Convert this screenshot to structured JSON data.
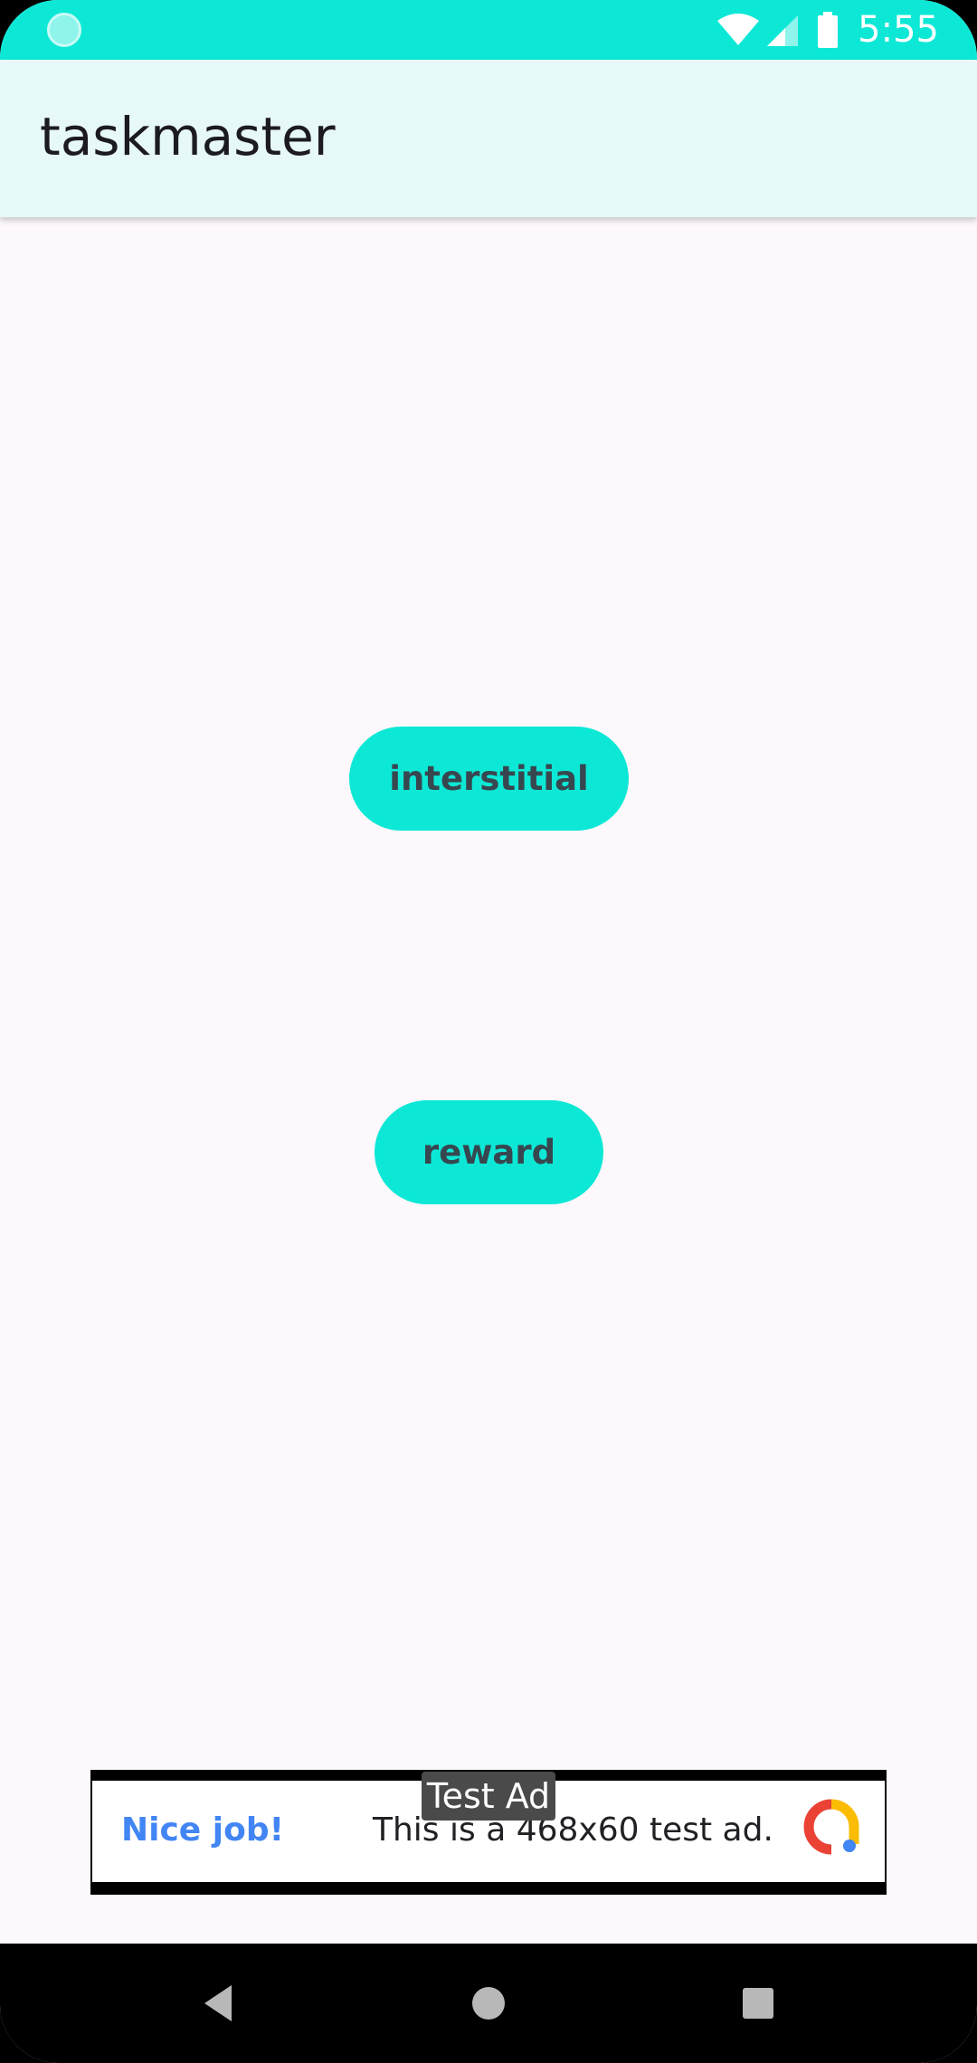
{
  "status_bar": {
    "time": "5:55",
    "icons": [
      "wifi-icon",
      "signal-icon",
      "battery-icon"
    ],
    "color": "#0de8d6"
  },
  "app_bar": {
    "title": "taskmaster"
  },
  "buttons": {
    "interstitial_label": "interstitial",
    "reward_label": "reward",
    "color": "#0de8d6"
  },
  "ad": {
    "tag": "Test Ad",
    "headline": "Nice job!",
    "body": "This is a 468x60 test ad.",
    "logo": "admob-logo-icon"
  },
  "nav_bar": {
    "icons": [
      "back-icon",
      "home-icon",
      "recents-icon"
    ]
  }
}
